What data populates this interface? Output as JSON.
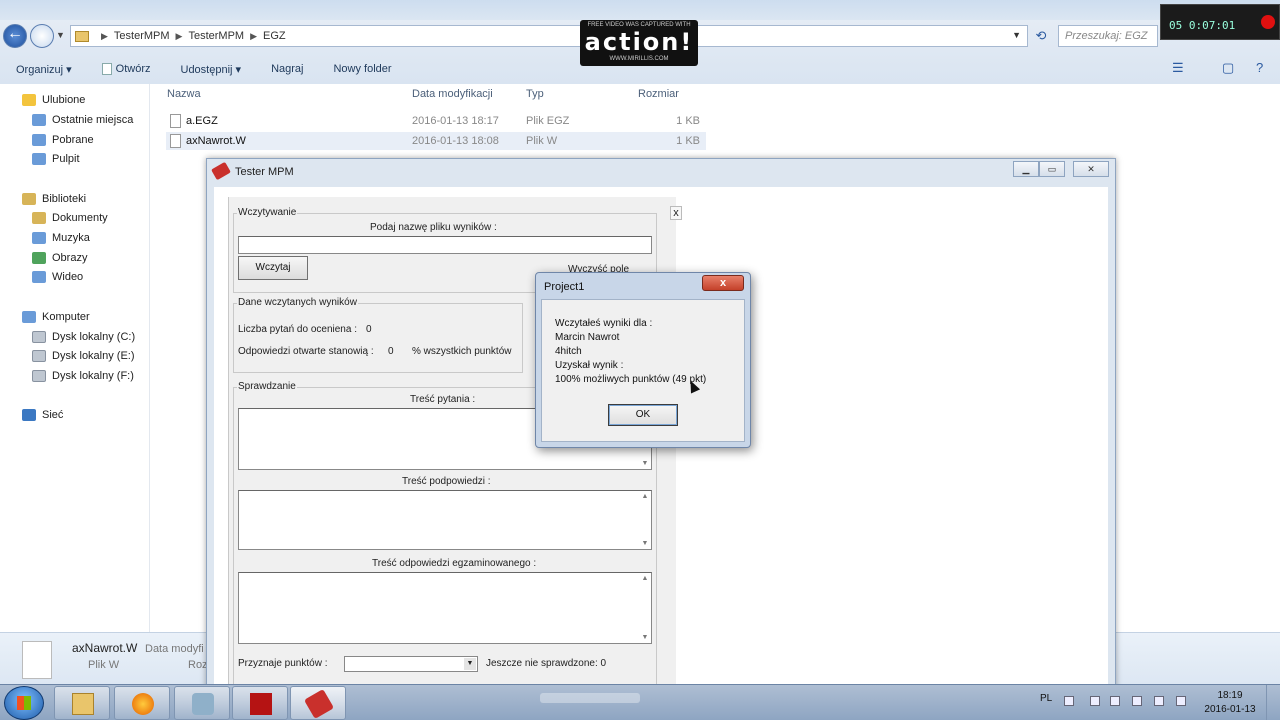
{
  "explorer": {
    "breadcrumbs": [
      "TesterMPM",
      "TesterMPM",
      "EGZ"
    ],
    "search_placeholder": "Przeszukaj: EGZ",
    "toolbar": [
      "Organizuj ▾",
      "Otwórz",
      "Udostępnij ▾",
      "Nagraj",
      "Nowy folder"
    ],
    "sidebar": {
      "favorites": {
        "title": "Ulubione",
        "items": [
          "Ostatnie miejsca",
          "Pobrane",
          "Pulpit"
        ]
      },
      "libraries": {
        "title": "Biblioteki",
        "items": [
          "Dokumenty",
          "Muzyka",
          "Obrazy",
          "Wideo"
        ]
      },
      "computer": {
        "title": "Komputer",
        "items": [
          "Dysk lokalny (C:)",
          "Dysk lokalny (E:)",
          "Dysk lokalny (F:)"
        ]
      },
      "network": {
        "title": "Sieć"
      }
    },
    "columns": {
      "name": "Nazwa",
      "date": "Data modyfikacji",
      "type": "Typ",
      "size": "Rozmiar"
    },
    "files": [
      {
        "name": "a.EGZ",
        "date": "2016-01-13 18:17",
        "type": "Plik EGZ",
        "size": "1 KB"
      },
      {
        "name": "axNawrot.W",
        "date": "2016-01-13 18:08",
        "type": "Plik W",
        "size": "1 KB"
      }
    ],
    "details": {
      "name": "axNawrot.W",
      "label": "Data modyfi",
      "type": "Plik W",
      "size_label": "Roz"
    }
  },
  "overlay": {
    "top_text": "FREE VIDEO WAS CAPTURED WITH",
    "brand": "action!",
    "url": "WWW.MIRILLIS.COM"
  },
  "recorder": {
    "time": "05 0:07:01"
  },
  "tester": {
    "title": "Tester MPM",
    "close_x": "x",
    "load_group": {
      "legend": "Wczytywanie",
      "prompt": "Podaj nazwę pliku wyników :",
      "load_button": "Wczytaj",
      "clear_button": "Wyczyść pole"
    },
    "results_group": {
      "legend": "Dane wczytanych wyników",
      "questions_label": "Liczba pytań do oceniena :",
      "questions_value": "0",
      "open_label": "Odpowiedzi otwarte stanowią :",
      "open_value": "0",
      "open_suffix": "% wszystkich punktów"
    },
    "check_group": {
      "legend": "Sprawdzanie",
      "question_label": "Treść pytania :",
      "hint_label": "Treść podpowiedzi :",
      "answer_label": "Treść odpowiedzi egzaminowanego :",
      "points_label": "Przyznaje punktów :",
      "status_text": "Jeszcze nie sprawdzone: 0"
    }
  },
  "dialog": {
    "title": "Project1",
    "close": "x",
    "lines": [
      "Wczytałeś wyniki dla :",
      "Marcin Nawrot",
      "4hitch",
      "Uzyskał wynik :",
      "100% możliwych punktów (49 pkt)"
    ],
    "ok": "OK"
  },
  "taskbar": {
    "language": "PL",
    "time": "18:19",
    "date": "2016-01-13"
  }
}
